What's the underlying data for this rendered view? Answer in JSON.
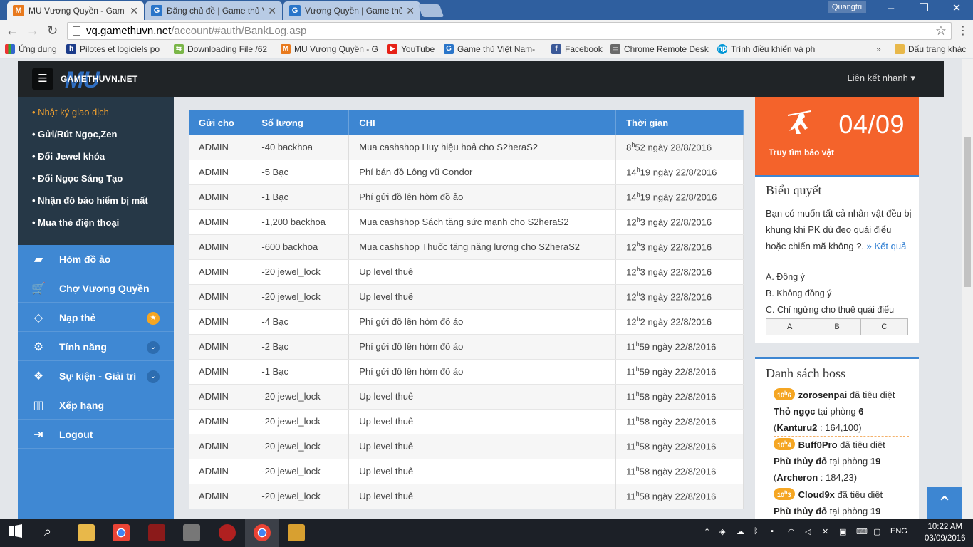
{
  "browser": {
    "tabs": [
      {
        "title": "MU Vương Quyền - Game",
        "active": true
      },
      {
        "title": "Đăng chủ đề | Game thủ V",
        "active": false
      },
      {
        "title": "Vương Quyền | Game thủ",
        "active": false
      }
    ],
    "profile_name": "Quangtri",
    "url_host": "vq.gamethuvn.net",
    "url_path": "/account/#auth/BankLog.asp",
    "bookmarks": [
      "Ứng dụng",
      "Pilotes et logiciels po",
      "Downloading File /62",
      "MU Vương Quyền - G",
      "YouTube",
      "Game thủ Việt Nam-",
      "Facebook",
      "Chrome Remote Desk",
      "Trình điều khiển và ph"
    ],
    "bookmarks_more": "»",
    "bookmarks_folder": "Dấu trang khác"
  },
  "site": {
    "logo_text": "GAMETHUVN.NET",
    "logo_mark": "MU",
    "quick_links": "Liên kết nhanh"
  },
  "sidebar": {
    "sublinks": [
      "• Nhật ký giao dịch",
      "• Gửi/Rút Ngọc,Zen",
      "• Đổi Jewel khóa",
      "• Đổi Ngọc Sáng Tạo",
      "• Nhận đồ bảo hiểm bị mất",
      "• Mua thẻ điện thoại"
    ],
    "menu": [
      {
        "label": "Hòm đồ ảo",
        "icon": "briefcase-icon"
      },
      {
        "label": "Chợ Vương Quyền",
        "icon": "cart-icon"
      },
      {
        "label": "Nạp thẻ",
        "icon": "diamond-icon",
        "badge": "★",
        "badge_color": "#f5a623"
      },
      {
        "label": "Tính năng",
        "icon": "gears-icon",
        "badge": "⌄",
        "badge_color": "#2d6db0"
      },
      {
        "label": "Sự kiện - Giải trí",
        "icon": "gift-icon",
        "badge": "⌄",
        "badge_color": "#2d6db0"
      },
      {
        "label": "Xếp hạng",
        "icon": "bar-chart-icon"
      },
      {
        "label": "Logout",
        "icon": "logout-icon"
      }
    ]
  },
  "table": {
    "headers": [
      "Gửi cho",
      "Số lượng",
      "CHI",
      "Thời gian"
    ],
    "rows": [
      {
        "to": "ADMIN",
        "amount": "-40  backhoa",
        "desc": "Mua cashshop Huy hiệu hoả cho S2heraS2",
        "h": "8",
        "m": "52",
        "date": "ngày 28/8/2016"
      },
      {
        "to": "ADMIN",
        "amount": "-5  Bạc",
        "desc": "Phí bán đồ Lông vũ Condor",
        "h": "14",
        "m": "19",
        "date": "ngày 22/8/2016"
      },
      {
        "to": "ADMIN",
        "amount": "-1  Bạc",
        "desc": "Phí gửi đồ lên hòm đồ ảo",
        "h": "14",
        "m": "19",
        "date": "ngày 22/8/2016"
      },
      {
        "to": "ADMIN",
        "amount": "-1,200  backhoa",
        "desc": "Mua cashshop Sách tăng sức mạnh cho S2heraS2",
        "h": "12",
        "m": "3",
        "date": "ngày 22/8/2016"
      },
      {
        "to": "ADMIN",
        "amount": "-600  backhoa",
        "desc": "Mua cashshop Thuốc tăng năng lượng cho S2heraS2",
        "h": "12",
        "m": "3",
        "date": "ngày 22/8/2016"
      },
      {
        "to": "ADMIN",
        "amount": "-20  jewel_lock",
        "desc": "Up level thuê",
        "h": "12",
        "m": "3",
        "date": "ngày 22/8/2016"
      },
      {
        "to": "ADMIN",
        "amount": "-20  jewel_lock",
        "desc": "Up level thuê",
        "h": "12",
        "m": "3",
        "date": "ngày 22/8/2016"
      },
      {
        "to": "ADMIN",
        "amount": "-4  Bạc",
        "desc": "Phí gửi đồ lên hòm đồ ảo",
        "h": "12",
        "m": "2",
        "date": "ngày 22/8/2016"
      },
      {
        "to": "ADMIN",
        "amount": "-2  Bạc",
        "desc": "Phí gửi đồ lên hòm đồ ảo",
        "h": "11",
        "m": "59",
        "date": "ngày 22/8/2016"
      },
      {
        "to": "ADMIN",
        "amount": "-1  Bạc",
        "desc": "Phí gửi đồ lên hòm đồ ảo",
        "h": "11",
        "m": "59",
        "date": "ngày 22/8/2016"
      },
      {
        "to": "ADMIN",
        "amount": "-20  jewel_lock",
        "desc": "Up level thuê",
        "h": "11",
        "m": "58",
        "date": "ngày 22/8/2016"
      },
      {
        "to": "ADMIN",
        "amount": "-20  jewel_lock",
        "desc": "Up level thuê",
        "h": "11",
        "m": "58",
        "date": "ngày 22/8/2016"
      },
      {
        "to": "ADMIN",
        "amount": "-20  jewel_lock",
        "desc": "Up level thuê",
        "h": "11",
        "m": "58",
        "date": "ngày 22/8/2016"
      },
      {
        "to": "ADMIN",
        "amount": "-20  jewel_lock",
        "desc": "Up level thuê",
        "h": "11",
        "m": "58",
        "date": "ngày 22/8/2016"
      },
      {
        "to": "ADMIN",
        "amount": "-20  jewel_lock",
        "desc": "Up level thuê",
        "h": "11",
        "m": "58",
        "date": "ngày 22/8/2016"
      }
    ],
    "hour_mark": "h"
  },
  "treasure": {
    "date": "04/09",
    "label": "Truy tìm bảo vật"
  },
  "vote": {
    "title": "Biểu quyết",
    "question": "Bạn có muốn tất cả nhân vật đều bị khụng khi PK dù đeo quái điểu hoặc chiến mã không ?.",
    "result_link": "» Kết quả",
    "options": [
      "A. Đồng ý",
      "B. Không đồng ý",
      "C. Chỉ ngừng cho thuê quái điểu"
    ],
    "buttons": [
      "A",
      "B",
      "C"
    ]
  },
  "boss": {
    "title": "Danh sách boss",
    "killed_text": "đã tiêu diệt",
    "room_text": "tại phòng",
    "entries": [
      {
        "h": "10",
        "m": "6",
        "player": "zorosenpai",
        "boss": "Thỏ ngọc",
        "room": "6",
        "map": "Kanturu2",
        "coord": " : 164,100)"
      },
      {
        "h": "10",
        "m": "4",
        "player": "Buff0Pro",
        "boss": "Phù thủy đỏ",
        "room": "19",
        "map": "Archeron",
        "coord": " : 184,23)"
      },
      {
        "h": "10",
        "m": "3",
        "player": "Cloud9x",
        "boss": "Phù thủy đỏ",
        "room": "19",
        "map": "",
        "coord": ""
      }
    ]
  },
  "taskbar": {
    "lang": "ENG",
    "time": "10:22 AM",
    "date": "03/09/2016"
  },
  "colors": {
    "accent": "#3d86d2",
    "sidebar_dark": "#263847",
    "orange": "#f4632b",
    "tab_blue": "#2f5f9f"
  }
}
